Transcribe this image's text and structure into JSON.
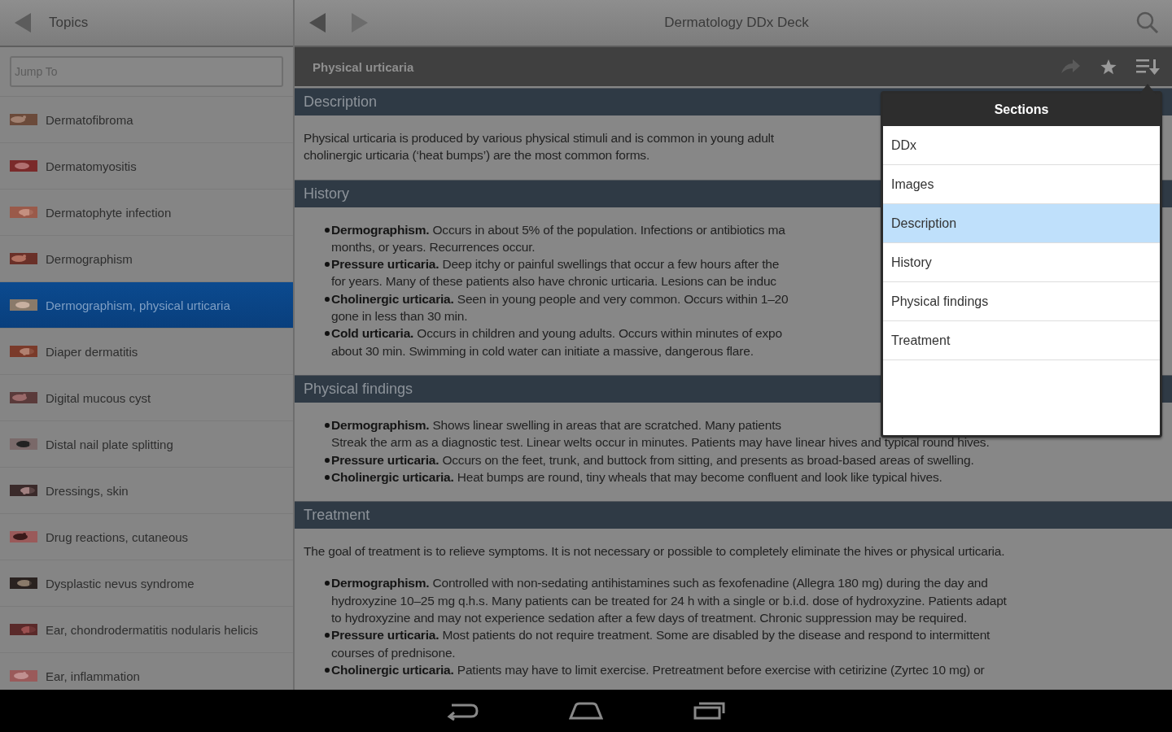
{
  "sidebar": {
    "title": "Topics",
    "search": {
      "placeholder": "Jump To"
    },
    "items": [
      {
        "label": "Dermatofibroma",
        "selected": false
      },
      {
        "label": "Dermatomyositis",
        "selected": false
      },
      {
        "label": "Dermatophyte infection",
        "selected": false
      },
      {
        "label": "Dermographism",
        "selected": false
      },
      {
        "label": "Dermographism, physical urticaria",
        "selected": true
      },
      {
        "label": "Diaper dermatitis",
        "selected": false
      },
      {
        "label": "Digital mucous cyst",
        "selected": false
      },
      {
        "label": "Distal nail plate splitting",
        "selected": false
      },
      {
        "label": "Dressings, skin",
        "selected": false
      },
      {
        "label": "Drug reactions, cutaneous",
        "selected": false
      },
      {
        "label": "Dysplastic nevus syndrome",
        "selected": false
      },
      {
        "label": "Ear, chondrodermatitis nodularis helicis",
        "selected": false
      },
      {
        "label": "Ear, inflammation",
        "selected": false
      }
    ]
  },
  "header": {
    "title": "Dermatology DDx Deck",
    "back": {
      "disabled": false
    },
    "forward": {
      "disabled": true
    }
  },
  "article": {
    "title": "Physical urticaria",
    "actions": [
      {
        "kind": "share",
        "disabled": true
      },
      {
        "kind": "star",
        "disabled": false
      },
      {
        "kind": "sections",
        "disabled": false
      }
    ],
    "sections": [
      {
        "heading": "Description",
        "intro": [
          "Physical urticaria is produced by various physical stimuli and is common in young adult",
          "cholinergic urticaria (‘heat bumps’) are the most common forms."
        ]
      },
      {
        "heading": "History",
        "bullets": [
          {
            "lines": [
              "**Dermographism.** Occurs in about 5% of the population. Infections or antibiotics ma",
              "months, or years. Recurrences occur."
            ]
          },
          {
            "lines": [
              "**Pressure urticaria.** Deep itchy or painful swellings that occur a few hours after the",
              "for years. Many of these patients also have chronic urticaria. Lesions can be induc"
            ]
          },
          {
            "lines": [
              "**Cholinergic urticaria.** Seen in young people and very common. Occurs within 1–20",
              "gone in less than 30 min."
            ]
          },
          {
            "lines": [
              "**Cold urticaria.** Occurs in children and young adults. Occurs within minutes of expo",
              "about 30 min. Swimming in cold water can initiate a massive, dangerous flare."
            ]
          }
        ]
      },
      {
        "heading": "Physical findings",
        "bullets": [
          {
            "lines": [
              "**Dermographism.** Shows linear swelling in areas that are scratched. Many patients",
              "Streak the arm as a diagnostic test. Linear welts occur in minutes. Patients may have linear hives and typical round hives."
            ]
          },
          {
            "lines": [
              "**Pressure urticaria.** Occurs on the feet, trunk, and buttock from sitting, and presents as broad-based areas of swelling."
            ]
          },
          {
            "lines": [
              "**Cholinergic urticaria.** Heat bumps are round, tiny wheals that may become confluent and look like typical hives."
            ]
          }
        ]
      },
      {
        "heading": "Treatment",
        "intro": [
          "The goal of treatment is to relieve symptoms. It is not necessary or possible to completely eliminate the hives or physical urticaria."
        ],
        "bullets": [
          {
            "lines": [
              "**Dermographism.** Controlled with non-sedating antihistamines such as fexofenadine (Allegra 180 mg) during the day and",
              "hydroxyzine 10–25 mg q.h.s. Many patients can be treated for 24 h with a single or b.i.d. dose of hydroxyzine. Patients adapt",
              "to hydroxyzine and may not experience sedation after a few days of treatment. Chronic suppression may be required."
            ]
          },
          {
            "lines": [
              "**Pressure urticaria.** Most patients do not require treatment. Some are disabled by the disease and respond to intermittent",
              "courses of prednisone."
            ]
          },
          {
            "lines": [
              "**Cholinergic urticaria.** Patients may have to limit exercise. Pretreatment before exercise with cetirizine (Zyrtec 10 mg) or"
            ]
          }
        ]
      }
    ]
  },
  "sections_menu": {
    "title": "Sections",
    "items": [
      {
        "label": "DDx",
        "selected": false
      },
      {
        "label": "Images",
        "selected": false
      },
      {
        "label": "Description",
        "selected": true
      },
      {
        "label": "History",
        "selected": false
      },
      {
        "label": "Physical findings",
        "selected": false
      },
      {
        "label": "Treatment",
        "selected": false
      }
    ]
  }
}
